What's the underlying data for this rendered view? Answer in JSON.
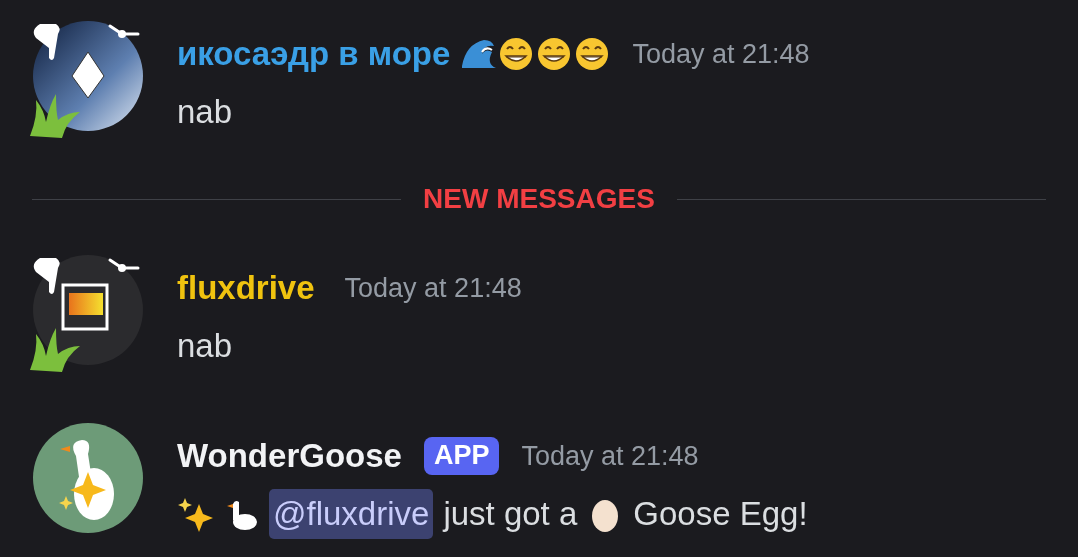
{
  "messages_before": [
    {
      "author": "икосаэдр в море",
      "color": "#3aa0e6",
      "name_emoji": [
        {
          "kind": "wave"
        },
        {
          "kind": "grin"
        },
        {
          "kind": "grin"
        },
        {
          "kind": "grin"
        }
      ],
      "timestamp": "Today at 21:48",
      "avatar": {
        "kind": "icosahedron"
      },
      "avatar_decoration": true,
      "parts": [
        {
          "kind": "text",
          "text": "nab"
        }
      ]
    }
  ],
  "new_messages_divider": {
    "label": "NEW MESSAGES"
  },
  "messages_after": [
    {
      "author": "fluxdrive",
      "color": "#f0c30f",
      "timestamp": "Today at 21:48",
      "avatar": {
        "kind": "window"
      },
      "avatar_decoration": true,
      "parts": [
        {
          "kind": "text",
          "text": "nab"
        }
      ]
    },
    {
      "author": "WonderGoose",
      "color": "#f2f3f5",
      "badge": "APP",
      "timestamp": "Today at 21:48",
      "avatar": {
        "kind": "goose"
      },
      "avatar_decoration": false,
      "parts": [
        {
          "kind": "sparkles"
        },
        {
          "kind": "goose"
        },
        {
          "kind": "mention",
          "text": "@fluxdrive"
        },
        {
          "kind": "text",
          "text": "just got a"
        },
        {
          "kind": "egg"
        },
        {
          "kind": "text",
          "text": "Goose Egg!"
        }
      ]
    }
  ]
}
